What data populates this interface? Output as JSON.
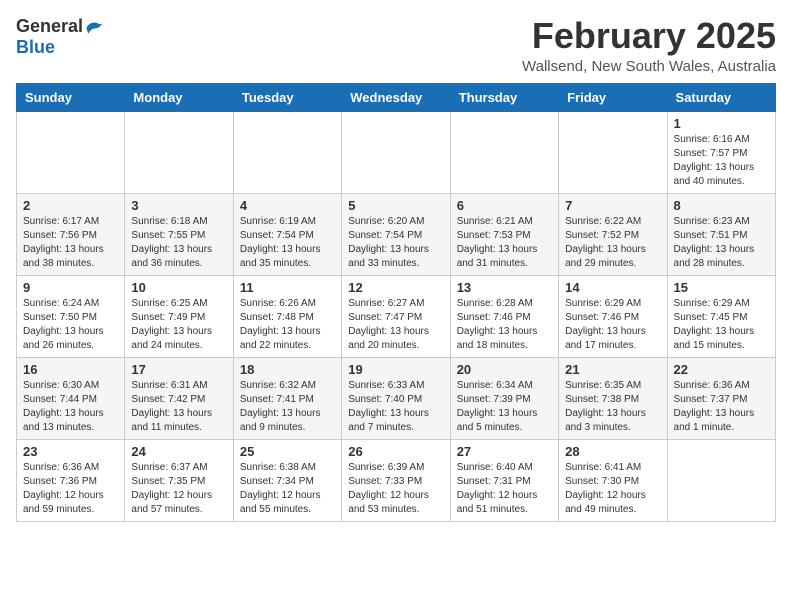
{
  "header": {
    "logo_general": "General",
    "logo_blue": "Blue",
    "title": "February 2025",
    "subtitle": "Wallsend, New South Wales, Australia"
  },
  "weekdays": [
    "Sunday",
    "Monday",
    "Tuesday",
    "Wednesday",
    "Thursday",
    "Friday",
    "Saturday"
  ],
  "weeks": [
    [
      {
        "day": "",
        "info": ""
      },
      {
        "day": "",
        "info": ""
      },
      {
        "day": "",
        "info": ""
      },
      {
        "day": "",
        "info": ""
      },
      {
        "day": "",
        "info": ""
      },
      {
        "day": "",
        "info": ""
      },
      {
        "day": "1",
        "info": "Sunrise: 6:16 AM\nSunset: 7:57 PM\nDaylight: 13 hours\nand 40 minutes."
      }
    ],
    [
      {
        "day": "2",
        "info": "Sunrise: 6:17 AM\nSunset: 7:56 PM\nDaylight: 13 hours\nand 38 minutes."
      },
      {
        "day": "3",
        "info": "Sunrise: 6:18 AM\nSunset: 7:55 PM\nDaylight: 13 hours\nand 36 minutes."
      },
      {
        "day": "4",
        "info": "Sunrise: 6:19 AM\nSunset: 7:54 PM\nDaylight: 13 hours\nand 35 minutes."
      },
      {
        "day": "5",
        "info": "Sunrise: 6:20 AM\nSunset: 7:54 PM\nDaylight: 13 hours\nand 33 minutes."
      },
      {
        "day": "6",
        "info": "Sunrise: 6:21 AM\nSunset: 7:53 PM\nDaylight: 13 hours\nand 31 minutes."
      },
      {
        "day": "7",
        "info": "Sunrise: 6:22 AM\nSunset: 7:52 PM\nDaylight: 13 hours\nand 29 minutes."
      },
      {
        "day": "8",
        "info": "Sunrise: 6:23 AM\nSunset: 7:51 PM\nDaylight: 13 hours\nand 28 minutes."
      }
    ],
    [
      {
        "day": "9",
        "info": "Sunrise: 6:24 AM\nSunset: 7:50 PM\nDaylight: 13 hours\nand 26 minutes."
      },
      {
        "day": "10",
        "info": "Sunrise: 6:25 AM\nSunset: 7:49 PM\nDaylight: 13 hours\nand 24 minutes."
      },
      {
        "day": "11",
        "info": "Sunrise: 6:26 AM\nSunset: 7:48 PM\nDaylight: 13 hours\nand 22 minutes."
      },
      {
        "day": "12",
        "info": "Sunrise: 6:27 AM\nSunset: 7:47 PM\nDaylight: 13 hours\nand 20 minutes."
      },
      {
        "day": "13",
        "info": "Sunrise: 6:28 AM\nSunset: 7:46 PM\nDaylight: 13 hours\nand 18 minutes."
      },
      {
        "day": "14",
        "info": "Sunrise: 6:29 AM\nSunset: 7:46 PM\nDaylight: 13 hours\nand 17 minutes."
      },
      {
        "day": "15",
        "info": "Sunrise: 6:29 AM\nSunset: 7:45 PM\nDaylight: 13 hours\nand 15 minutes."
      }
    ],
    [
      {
        "day": "16",
        "info": "Sunrise: 6:30 AM\nSunset: 7:44 PM\nDaylight: 13 hours\nand 13 minutes."
      },
      {
        "day": "17",
        "info": "Sunrise: 6:31 AM\nSunset: 7:42 PM\nDaylight: 13 hours\nand 11 minutes."
      },
      {
        "day": "18",
        "info": "Sunrise: 6:32 AM\nSunset: 7:41 PM\nDaylight: 13 hours\nand 9 minutes."
      },
      {
        "day": "19",
        "info": "Sunrise: 6:33 AM\nSunset: 7:40 PM\nDaylight: 13 hours\nand 7 minutes."
      },
      {
        "day": "20",
        "info": "Sunrise: 6:34 AM\nSunset: 7:39 PM\nDaylight: 13 hours\nand 5 minutes."
      },
      {
        "day": "21",
        "info": "Sunrise: 6:35 AM\nSunset: 7:38 PM\nDaylight: 13 hours\nand 3 minutes."
      },
      {
        "day": "22",
        "info": "Sunrise: 6:36 AM\nSunset: 7:37 PM\nDaylight: 13 hours\nand 1 minute."
      }
    ],
    [
      {
        "day": "23",
        "info": "Sunrise: 6:36 AM\nSunset: 7:36 PM\nDaylight: 12 hours\nand 59 minutes."
      },
      {
        "day": "24",
        "info": "Sunrise: 6:37 AM\nSunset: 7:35 PM\nDaylight: 12 hours\nand 57 minutes."
      },
      {
        "day": "25",
        "info": "Sunrise: 6:38 AM\nSunset: 7:34 PM\nDaylight: 12 hours\nand 55 minutes."
      },
      {
        "day": "26",
        "info": "Sunrise: 6:39 AM\nSunset: 7:33 PM\nDaylight: 12 hours\nand 53 minutes."
      },
      {
        "day": "27",
        "info": "Sunrise: 6:40 AM\nSunset: 7:31 PM\nDaylight: 12 hours\nand 51 minutes."
      },
      {
        "day": "28",
        "info": "Sunrise: 6:41 AM\nSunset: 7:30 PM\nDaylight: 12 hours\nand 49 minutes."
      },
      {
        "day": "",
        "info": ""
      }
    ]
  ]
}
